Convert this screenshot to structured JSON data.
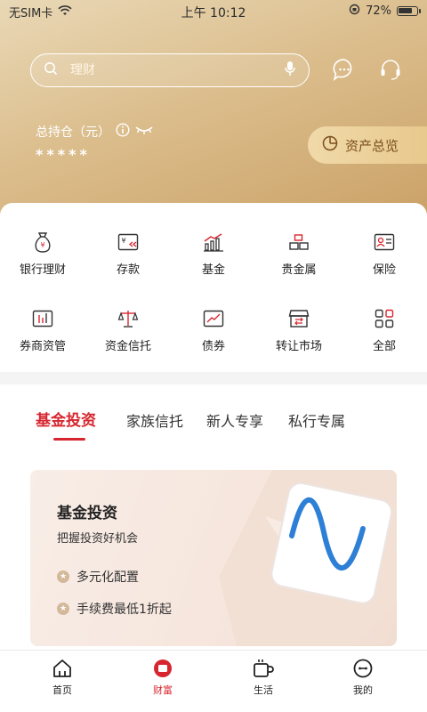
{
  "status_bar": {
    "carrier": "无SIM卡",
    "time": "上午 10:12",
    "battery": "72%"
  },
  "search": {
    "placeholder": "理财"
  },
  "holding": {
    "label": "总持仓（元）",
    "value": "*****"
  },
  "overview_button": {
    "label": "资产总览"
  },
  "menu": {
    "items": [
      {
        "label": "银行理财",
        "icon": "money-bag-icon"
      },
      {
        "label": "存款",
        "icon": "deposit-icon"
      },
      {
        "label": "基金",
        "icon": "fund-chart-icon"
      },
      {
        "label": "贵金属",
        "icon": "gold-bars-icon"
      },
      {
        "label": "保险",
        "icon": "insurance-card-icon"
      },
      {
        "label": "券商资管",
        "icon": "broker-chart-icon"
      },
      {
        "label": "资金信托",
        "icon": "scale-icon"
      },
      {
        "label": "债券",
        "icon": "bond-chart-icon"
      },
      {
        "label": "转让市场",
        "icon": "market-store-icon"
      },
      {
        "label": "全部",
        "icon": "grid-all-icon"
      }
    ]
  },
  "product_tabs": {
    "items": [
      "基金投资",
      "家族信托",
      "新人专享",
      "私行专属"
    ],
    "active": "基金投资"
  },
  "promo": {
    "title": "基金投资",
    "subtitle": "把握投资好机会",
    "features": [
      "多元化配置",
      "手续费最低1折起"
    ]
  },
  "tabbar": {
    "items": [
      {
        "label": "首页",
        "icon": "home-icon"
      },
      {
        "label": "财富",
        "icon": "wealth-icon"
      },
      {
        "label": "生活",
        "icon": "coffee-icon"
      },
      {
        "label": "我的",
        "icon": "profile-icon"
      }
    ],
    "active": "财富"
  },
  "colors": {
    "accent": "#d7262f",
    "gold": "#caa065"
  }
}
